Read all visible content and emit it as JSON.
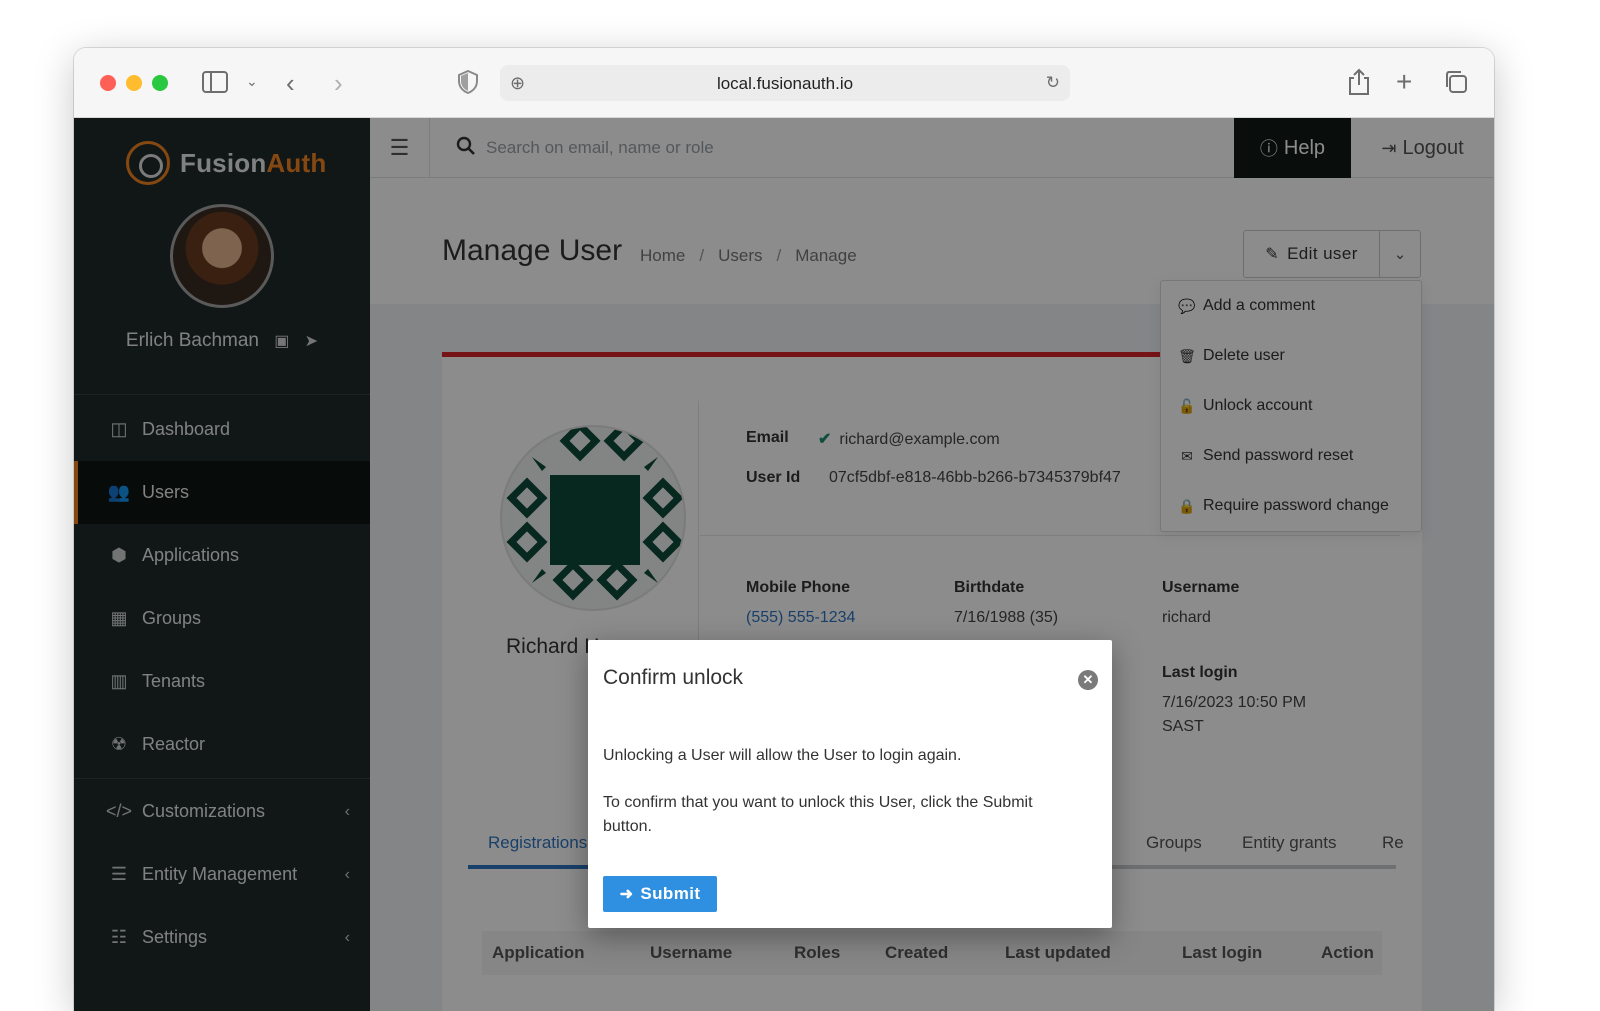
{
  "browser": {
    "url": "local.fusionauth.io"
  },
  "brand": {
    "name_part1": "Fusion",
    "name_part2": "Auth",
    "accent_color": "#f58320",
    "sidebar_color": "#202b2a"
  },
  "sidebar": {
    "user_name": "Erlich Bachman",
    "items": [
      {
        "label": "Dashboard",
        "icon": "dashboard-icon",
        "active": false
      },
      {
        "label": "Users",
        "icon": "users-icon",
        "active": true
      },
      {
        "label": "Applications",
        "icon": "cube-icon",
        "active": false
      },
      {
        "label": "Groups",
        "icon": "groups-icon",
        "active": false
      },
      {
        "label": "Tenants",
        "icon": "building-icon",
        "active": false
      },
      {
        "label": "Reactor",
        "icon": "radiation-icon",
        "active": false
      },
      {
        "label": "Customizations",
        "icon": "code-icon",
        "active": false,
        "expandable": true
      },
      {
        "label": "Entity Management",
        "icon": "server-icon",
        "active": false,
        "expandable": true
      },
      {
        "label": "Settings",
        "icon": "sliders-icon",
        "active": false,
        "expandable": true
      }
    ]
  },
  "topbar": {
    "search_placeholder": "Search on email, name or role",
    "help_label": "Help",
    "logout_label": "Logout"
  },
  "page": {
    "title": "Manage User",
    "breadcrumb": [
      "Home",
      "Users",
      "Manage"
    ],
    "edit_label": "Edit user"
  },
  "dropdown": {
    "items": [
      {
        "label": "Add a comment",
        "icon": "comment-icon"
      },
      {
        "label": "Delete user",
        "icon": "trash-icon"
      },
      {
        "label": "Unlock account",
        "icon": "unlock-icon"
      },
      {
        "label": "Send password reset",
        "icon": "envelope-icon"
      },
      {
        "label": "Require password change",
        "icon": "lock-icon"
      }
    ]
  },
  "user": {
    "name_visible": "Richard H",
    "email_label": "Email",
    "email": "richard@example.com",
    "userid_label": "User Id",
    "userid": "07cf5dbf-e818-46bb-b266-b7345379bf47",
    "phone_label": "Mobile Phone",
    "phone": "(555) 555-1234",
    "birthdate_label": "Birthdate",
    "birthdate": "7/16/1988 (35)",
    "username_label": "Username",
    "username": "richard",
    "lastlogin_label": "Last login",
    "lastlogin_line1": "7/16/2023 10:50 PM",
    "lastlogin_line2": "SAST"
  },
  "tabs": [
    "Registrations",
    "Groups",
    "Entity grants",
    "Re"
  ],
  "table": {
    "columns": [
      "Application",
      "Username",
      "Roles",
      "Created",
      "Last updated",
      "Last login",
      "Action"
    ]
  },
  "modal": {
    "title": "Confirm unlock",
    "text1": "Unlocking a User will allow the User to login again.",
    "text2": "To confirm that you want to unlock this User, click the Submit button.",
    "submit_label": "Submit"
  }
}
